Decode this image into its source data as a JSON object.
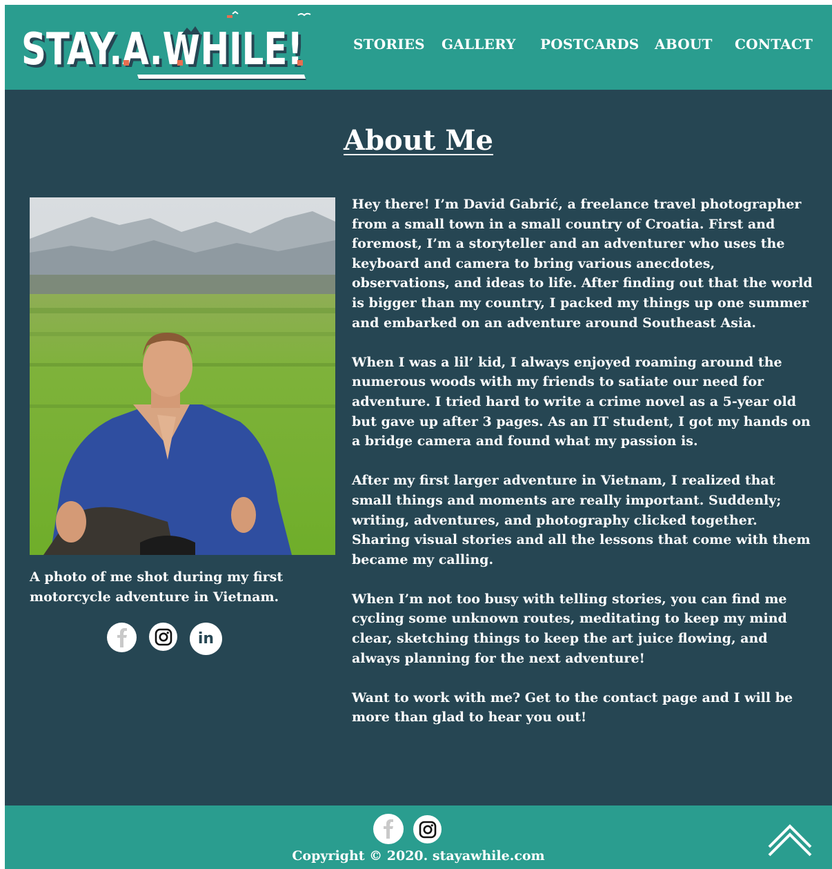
{
  "header": {
    "logo_text": "STAY.A.WHILE!",
    "nav": [
      "STORIES",
      "GALLERY",
      "POSTCARDS",
      "ABOUT",
      "CONTACT"
    ]
  },
  "main": {
    "title": "About Me",
    "photo_caption": "A photo of me shot during my first motorcycle adventure in Vietnam.",
    "social_icons": [
      "facebook-icon",
      "instagram-icon",
      "linkedin-icon"
    ],
    "bio": [
      "Hey there! I’m David Gabrić, a freelance travel photographer from a small town in a small country of Croatia. First and foremost, I’m a storyteller and an adventurer who uses the keyboard and camera to bring various anecdotes, observations, and ideas to life. After finding out that the world is bigger than my country, I packed my things up one summer and embarked on an adventure around Southeast Asia.",
      "When I was a lil’ kid, I always enjoyed roaming around the numerous woods with my friends to satiate our need for adventure. I tried hard to write a crime novel as a 5-year old but gave up after 3 pages. As an IT student, I got my hands on a bridge camera and found what my passion is.",
      "After my first larger adventure in Vietnam, I realized that small things and moments are really important. Suddenly; writing, adventures, and photography clicked together. Sharing visual stories and all the lessons that come with them became my calling.",
      "When I’m not too busy with telling stories, you can find me cycling some unknown routes, meditating to keep my mind clear, sketching things to keep the art juice flowing, and always planning for the next adventure!",
      "Want to work with me? Get to the contact page and I will be more than glad to hear you out!"
    ]
  },
  "footer": {
    "social_icons": [
      "facebook-icon",
      "instagram-icon"
    ],
    "copyright": "Copyright © 2020. stayawhile.com",
    "back_to_top_icon": "chevron-up-icon"
  },
  "colors": {
    "header_bg": "#2a9d8f",
    "main_bg": "#264653",
    "accent": "#e76f51",
    "text": "#ffffff"
  }
}
